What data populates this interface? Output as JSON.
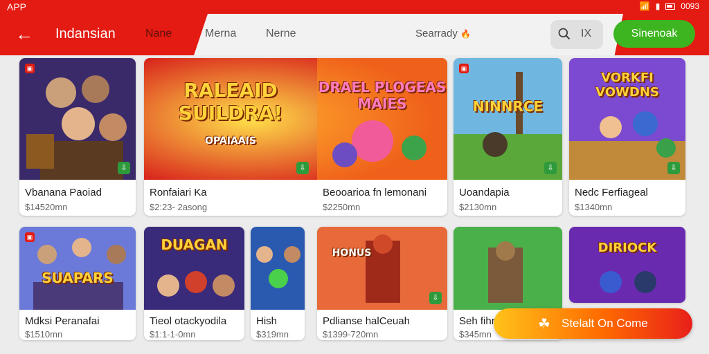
{
  "status_bar": {
    "app_label": "APP",
    "time": "0093"
  },
  "app_bar": {
    "title": "Indansian",
    "tabs": [
      "Nane",
      "Merna",
      "Nerne"
    ],
    "sort_label": "Searrady",
    "close_label": "IX",
    "signup_label": "Sinenoak"
  },
  "games": [
    {
      "name": "Vbanana Paoiad",
      "price": "$14520mn",
      "art_title": ""
    },
    {
      "name": "Ronfaiari Ka",
      "price": "$2:23- 2asong",
      "art_title": "RALEAID SUILDRA!",
      "art_subtitle": "OPAIAAIS"
    },
    {
      "name": "Beooarioa fn lemonani",
      "price": "$2250mn",
      "art_title": "DRAEL PLOGEAS MAIES"
    },
    {
      "name": "Uoandapia",
      "price": "$2130mn",
      "art_title": "NINNRCE"
    },
    {
      "name": "Nedc Ferfiageal",
      "price": "$1340mn",
      "art_title": "VORKFI VOWDNS"
    },
    {
      "name": "Mdksi Peranafai",
      "price": "$1510mn",
      "art_title": "SUAPARS"
    },
    {
      "name": "Tieol otackyodila",
      "price": "$1:1-1-0mn",
      "art_title": "DUAGAN"
    },
    {
      "name": "Hish",
      "price": "$319mn",
      "art_title": ""
    },
    {
      "name": "Pdlianse halCeuah",
      "price": "$1399-720mn",
      "art_title": "HONUS"
    },
    {
      "name": "Seh fihraie",
      "price": "$345mn",
      "art_title": ""
    },
    {
      "name": "",
      "price": "",
      "art_title": "DIRIOCK"
    }
  ],
  "cta": {
    "label": "Stelalt On Come"
  },
  "colors": {
    "primary": "#e31b12",
    "accent_green": "#3db521"
  },
  "icons": [
    "back-arrow-icon",
    "wifi-icon",
    "battery-icon",
    "search-icon",
    "close-icon",
    "badge-icon",
    "download-icon",
    "gift-icon"
  ]
}
